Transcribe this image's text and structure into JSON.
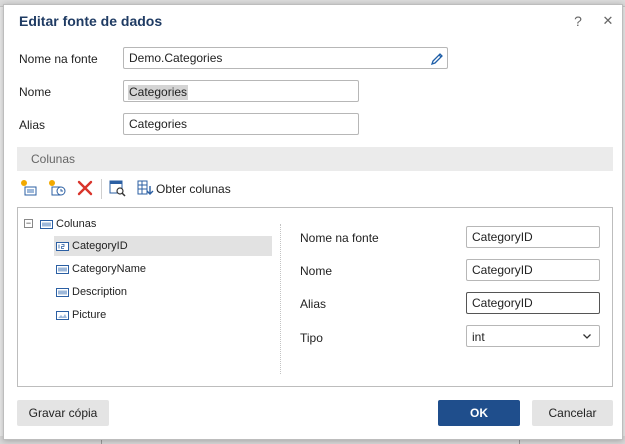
{
  "dialog": {
    "title": "Editar fonte de dados",
    "help_icon": "?",
    "close_icon": "✕"
  },
  "form": {
    "source_name_label": "Nome na fonte",
    "source_name_value": "Demo.Categories",
    "name_label": "Nome",
    "name_value": "Categories",
    "alias_label": "Alias",
    "alias_value": "Categories"
  },
  "section": {
    "title": "Colunas"
  },
  "toolbar": {
    "icons": [
      "new-column-icon",
      "new-calculated-column-icon",
      "delete-icon",
      "preview-data-icon",
      "retrieve-columns-icon"
    ],
    "retrieve_label": "Obter colunas"
  },
  "tree": {
    "expander": "−",
    "root_label": "Colunas",
    "items": [
      {
        "label": "CategoryID",
        "type_icon": "numeric-column-icon",
        "selected": true
      },
      {
        "label": "CategoryName",
        "type_icon": "string-column-icon",
        "selected": false
      },
      {
        "label": "Description",
        "type_icon": "string-column-icon",
        "selected": false
      },
      {
        "label": "Picture",
        "type_icon": "image-column-icon",
        "selected": false
      }
    ]
  },
  "properties": {
    "source_name_label": "Nome na fonte",
    "source_name_value": "CategoryID",
    "name_label": "Nome",
    "name_value": "CategoryID",
    "alias_label": "Alias",
    "alias_value": "CategoryID",
    "type_label": "Tipo",
    "type_value": "int"
  },
  "buttons": {
    "save_copy": "Gravar cópia",
    "ok": "OK",
    "cancel": "Cancelar"
  },
  "colors": {
    "title": "#1f3b63",
    "primary_button": "#1f4e8c",
    "delete_icon": "#d9342b"
  }
}
